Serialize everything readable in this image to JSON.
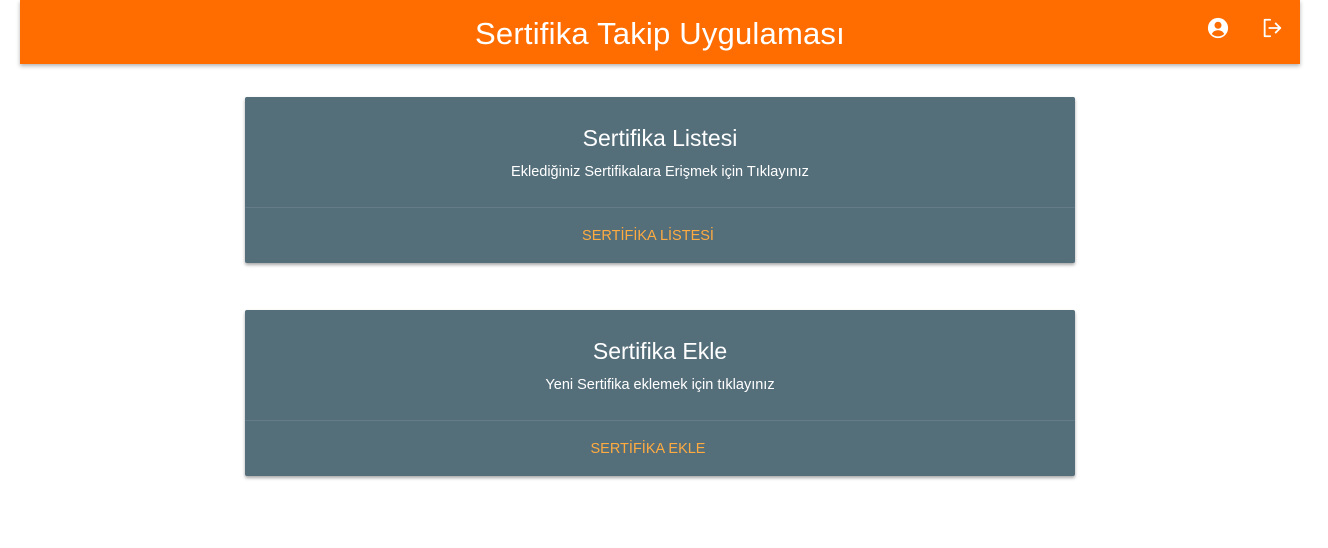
{
  "header": {
    "title": "Sertifika Takip Uygulaması",
    "account_icon": "account-circle-icon",
    "logout_icon": "logout-icon",
    "bg_color": "#ff6d00"
  },
  "cards": [
    {
      "title": "Sertifika Listesi",
      "subtitle": "Eklediğiniz Sertifikalara Erişmek için Tıklayınız",
      "action_label": "SERTİFİKA LİSTESİ"
    },
    {
      "title": "Sertifika Ekle",
      "subtitle": "Yeni Sertifika eklemek için tıklayınız",
      "action_label": "SERTİFİKA EKLE"
    }
  ],
  "colors": {
    "card_bg": "#546e7a",
    "link": "#ffab40"
  }
}
